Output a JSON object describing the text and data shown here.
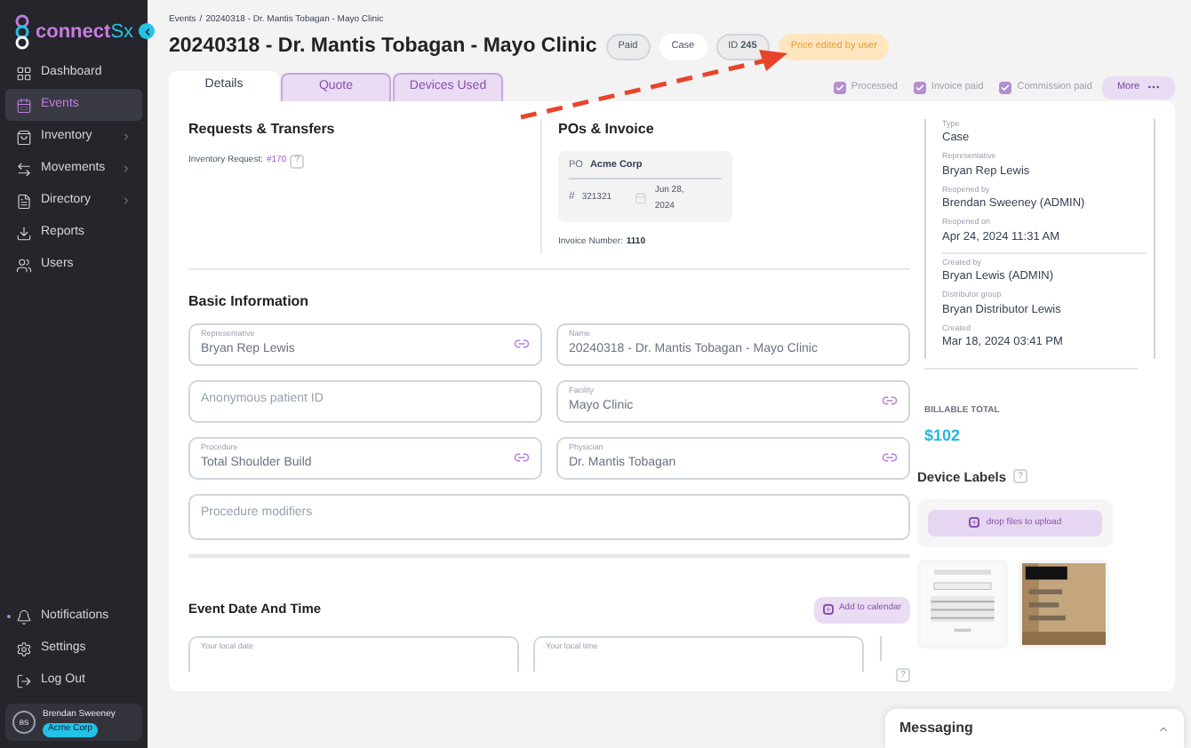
{
  "sidebar": {
    "logo": {
      "brand": "connect",
      "suffix": "Sx"
    },
    "items": [
      {
        "label": "Dashboard",
        "selected": false,
        "has_submenu": false
      },
      {
        "label": "Events",
        "selected": true,
        "has_submenu": false
      },
      {
        "label": "Inventory",
        "selected": false,
        "has_submenu": true
      },
      {
        "label": "Movements",
        "selected": false,
        "has_submenu": true
      },
      {
        "label": "Directory",
        "selected": false,
        "has_submenu": true
      },
      {
        "label": "Reports",
        "selected": false,
        "has_submenu": false
      },
      {
        "label": "Users",
        "selected": false,
        "has_submenu": false
      }
    ],
    "bottom_items": [
      {
        "label": "Notifications",
        "unread": true
      },
      {
        "label": "Settings",
        "unread": false
      },
      {
        "label": "Log Out",
        "unread": false
      }
    ],
    "user": {
      "initials": "BS",
      "name": "Brendan Sweeney",
      "org": "Acme Corp"
    }
  },
  "header": {
    "breadcrumb": [
      "Events",
      "20240318 - Dr. Mantis Tobagan - Mayo Clinic"
    ],
    "breadcrumb_separator": "/",
    "title": "20240318 - Dr. Mantis Tobagan - Mayo Clinic",
    "badges": [
      {
        "text": "Paid",
        "kind": "grey"
      },
      {
        "text": "Case",
        "kind": "white"
      },
      {
        "text": "ID **245**",
        "kind": "grey"
      },
      {
        "text": "Price edited by user",
        "kind": "warning"
      }
    ]
  },
  "tabs": [
    {
      "label": "Details",
      "selected": true
    },
    {
      "label": "Quote",
      "selected": false
    },
    {
      "label": "Devices Used",
      "selected": false
    }
  ],
  "flags": [
    {
      "label": "Processed",
      "checked": true
    },
    {
      "label": "Invoice paid",
      "checked": true
    },
    {
      "label": "Commission paid",
      "checked": true
    }
  ],
  "more_button": "More",
  "requests": {
    "heading": "Requests & Transfers",
    "label": "Inventory Request:",
    "link": "#170",
    "help": "?"
  },
  "pos": {
    "heading": "POs & Invoice",
    "po_label": "PO",
    "company": "Acme Corp",
    "number_symbol": "#",
    "number": "321321",
    "date": "Jun 28, 2024",
    "invoice_label": "Invoice Number:",
    "invoice_number": "1110"
  },
  "basic_info": {
    "heading": "Basic Information",
    "rows": [
      [
        {
          "label": "Representative",
          "value": "Bryan Rep Lewis",
          "linked": true
        },
        {
          "label": "Name",
          "value": "20240318 - Dr. Mantis Tobagan - Mayo Clinic",
          "linked": false
        }
      ],
      [
        {
          "placeholder": "Anonymous patient ID",
          "linked": false
        },
        {
          "label": "Facility",
          "value": "Mayo Clinic",
          "linked": true
        }
      ],
      [
        {
          "label": "Procedure",
          "value": "Total Shoulder Build",
          "linked": true
        },
        {
          "label": "Physician",
          "value": "Dr. Mantis Tobagan",
          "linked": true
        }
      ],
      [
        {
          "placeholder": "Procedure modifiers",
          "linked": false
        }
      ]
    ]
  },
  "event_date": {
    "heading": "Event Date And Time",
    "button": "Add to calendar",
    "fields": [
      "Your local date",
      "Your local time"
    ],
    "help": "?"
  },
  "details": [
    [
      {
        "label": "Type",
        "value": "Case"
      },
      {
        "label": "Representative",
        "value": "Bryan Rep Lewis"
      },
      {
        "label": "Reopened by",
        "value": "Brendan Sweeney (ADMIN)"
      },
      {
        "label": "Reopened on",
        "value": "Apr 24, 2024 11:31 AM"
      }
    ],
    [
      {
        "label": "Created by",
        "value": "Bryan Lewis (ADMIN)"
      },
      {
        "label": "Distributor group",
        "value": "Bryan Distributor Lewis"
      },
      {
        "label": "Created",
        "value": "Mar 18, 2024 03:41 PM"
      }
    ]
  ],
  "billable": {
    "label": "BILLABLE TOTAL",
    "value": "$102"
  },
  "device_labels": {
    "heading": "Device Labels",
    "help": "?",
    "upload": "drop files to upload"
  },
  "messaging": {
    "title": "Messaging"
  }
}
